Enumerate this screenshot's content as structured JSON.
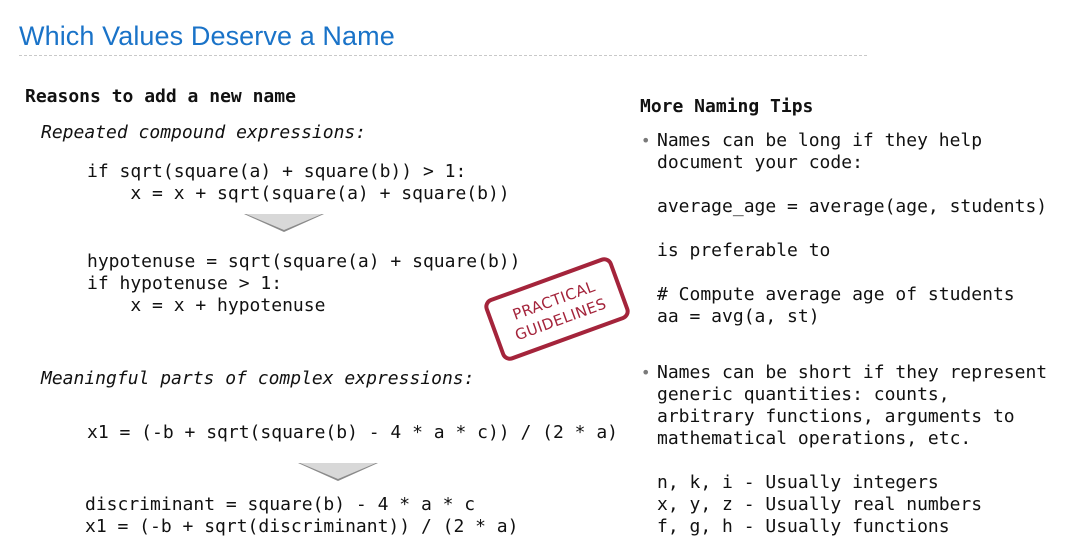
{
  "slide": {
    "title": "Which Values Deserve a Name"
  },
  "left": {
    "heading": "Reasons to add a new name",
    "section1_label": "Repeated compound expressions:",
    "code1": "if sqrt(square(a) + square(b)) > 1:\n    x = x + sqrt(square(a) + square(b))",
    "code2": "hypotenuse = sqrt(square(a) + square(b))\nif hypotenuse > 1:\n    x = x + hypotenuse",
    "section2_label": "Meaningful parts of complex expressions:",
    "code3": "x1 = (-b + sqrt(square(b) - 4 * a * c)) / (2 * a)",
    "code4": "discriminant = square(b) - 4 * a * c\nx1 = (-b + sqrt(discriminant)) / (2 * a)"
  },
  "stamp": {
    "line1": "PRACTICAL",
    "line2": "GUIDELINES",
    "color": "#a4243b"
  },
  "right": {
    "heading": "More Naming Tips",
    "tip1": "Names can be long if they help\ndocument your code:",
    "tip1_example": "average_age = average(age, students)",
    "tip1_middle": "is preferable to",
    "tip1_counter": "# Compute average age of students\naa = avg(a, st)",
    "tip2": "Names can be short if they represent\ngeneric quantities: counts,\narbitrary functions, arguments to\nmathematical operations, etc.",
    "tip2_examples": "n, k, i - Usually integers\nx, y, z - Usually real numbers\nf, g, h - Usually functions"
  },
  "colors": {
    "title": "#1a73c8",
    "arrow": "#8a8a8a"
  }
}
